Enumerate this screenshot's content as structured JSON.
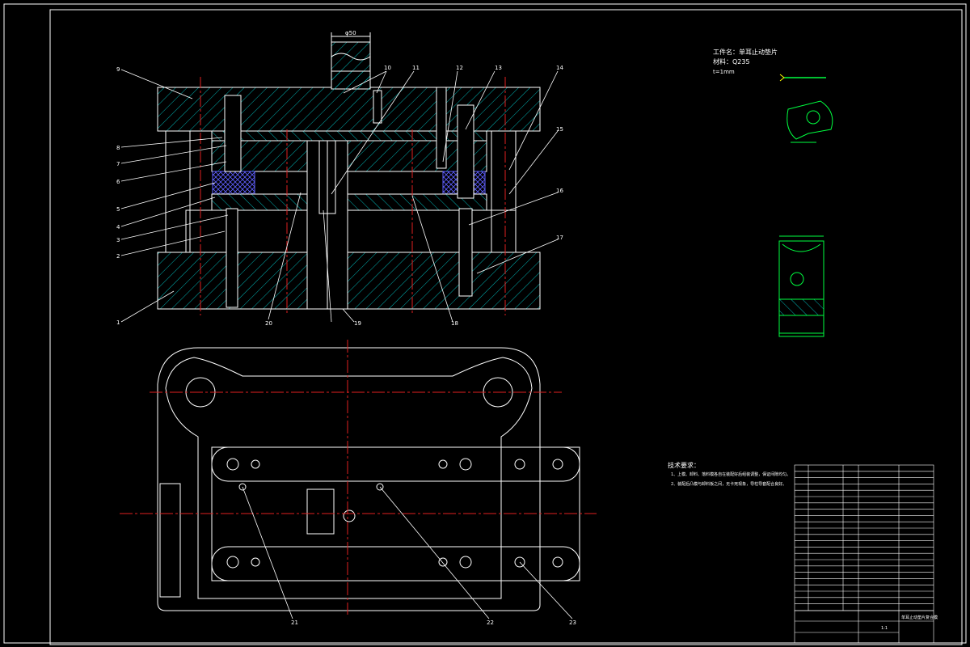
{
  "colors": {
    "background": "#000000",
    "outline": "#ffffff",
    "hatch": "#00c8c8",
    "centerline": "#e02020",
    "rubber": "#2828c8",
    "part_detail": "#00ff40",
    "highlight": "#ffff00"
  },
  "header": {
    "dimension_top": "φ50"
  },
  "part_labels_left": [
    "9",
    "8",
    "7",
    "6",
    "5",
    "4",
    "3",
    "2",
    "1"
  ],
  "part_labels_top": [
    "10",
    "11",
    "12",
    "13",
    "14"
  ],
  "part_labels_right": [
    "15",
    "16",
    "17"
  ],
  "part_labels_bottom": [
    "20",
    "19",
    "18"
  ],
  "part_labels_plan": [
    "21",
    "22",
    "23"
  ],
  "workpiece_note": {
    "line1": "工件名：单耳止动垫片",
    "line2": "材料：Q235",
    "line3": "t=1mm"
  },
  "tech_requirements": {
    "title": "技术要求：",
    "line1": "1、上模、卸料、落料模各自在装配好后组装调整，保证间隙均匀。",
    "line2": "2、装配后凸模与卸料板之间，无卡死现象，导柱导套配合良好。"
  },
  "title_block": {
    "drawing_title": "单耳止动垫片复合模",
    "scale": "1:1"
  }
}
